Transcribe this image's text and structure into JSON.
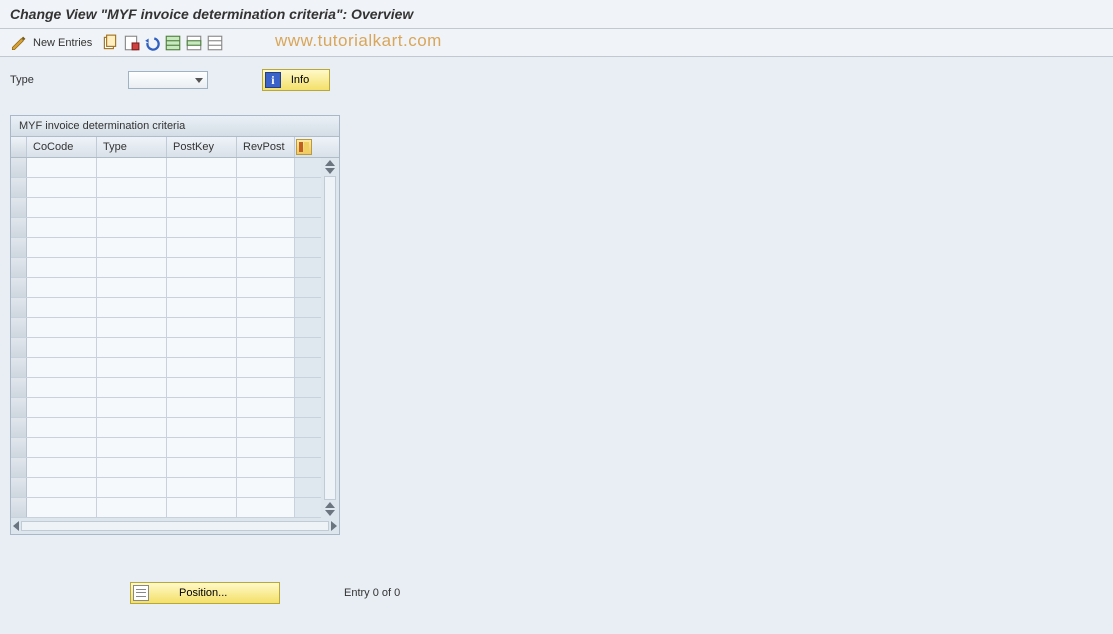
{
  "title": "Change View \"MYF invoice determination criteria\": Overview",
  "toolbar": {
    "new_entries_label": "New Entries"
  },
  "watermark": "www.tutorialkart.com",
  "filter": {
    "type_label": "Type",
    "selected_value": "",
    "info_label": "Info"
  },
  "table": {
    "title": "MYF invoice determination criteria",
    "columns": {
      "cocode": "CoCode",
      "type": "Type",
      "postkey": "PostKey",
      "revpost": "RevPost"
    },
    "row_count": 18
  },
  "footer": {
    "position_label": "Position...",
    "entry_status": "Entry 0 of 0"
  },
  "icons": {
    "toggle": "toggle-display-change",
    "copy": "copy",
    "delete": "delete",
    "undo": "undo",
    "select_all": "select-all",
    "select_block": "select-block",
    "deselect_all": "deselect-all",
    "config": "table-settings"
  }
}
